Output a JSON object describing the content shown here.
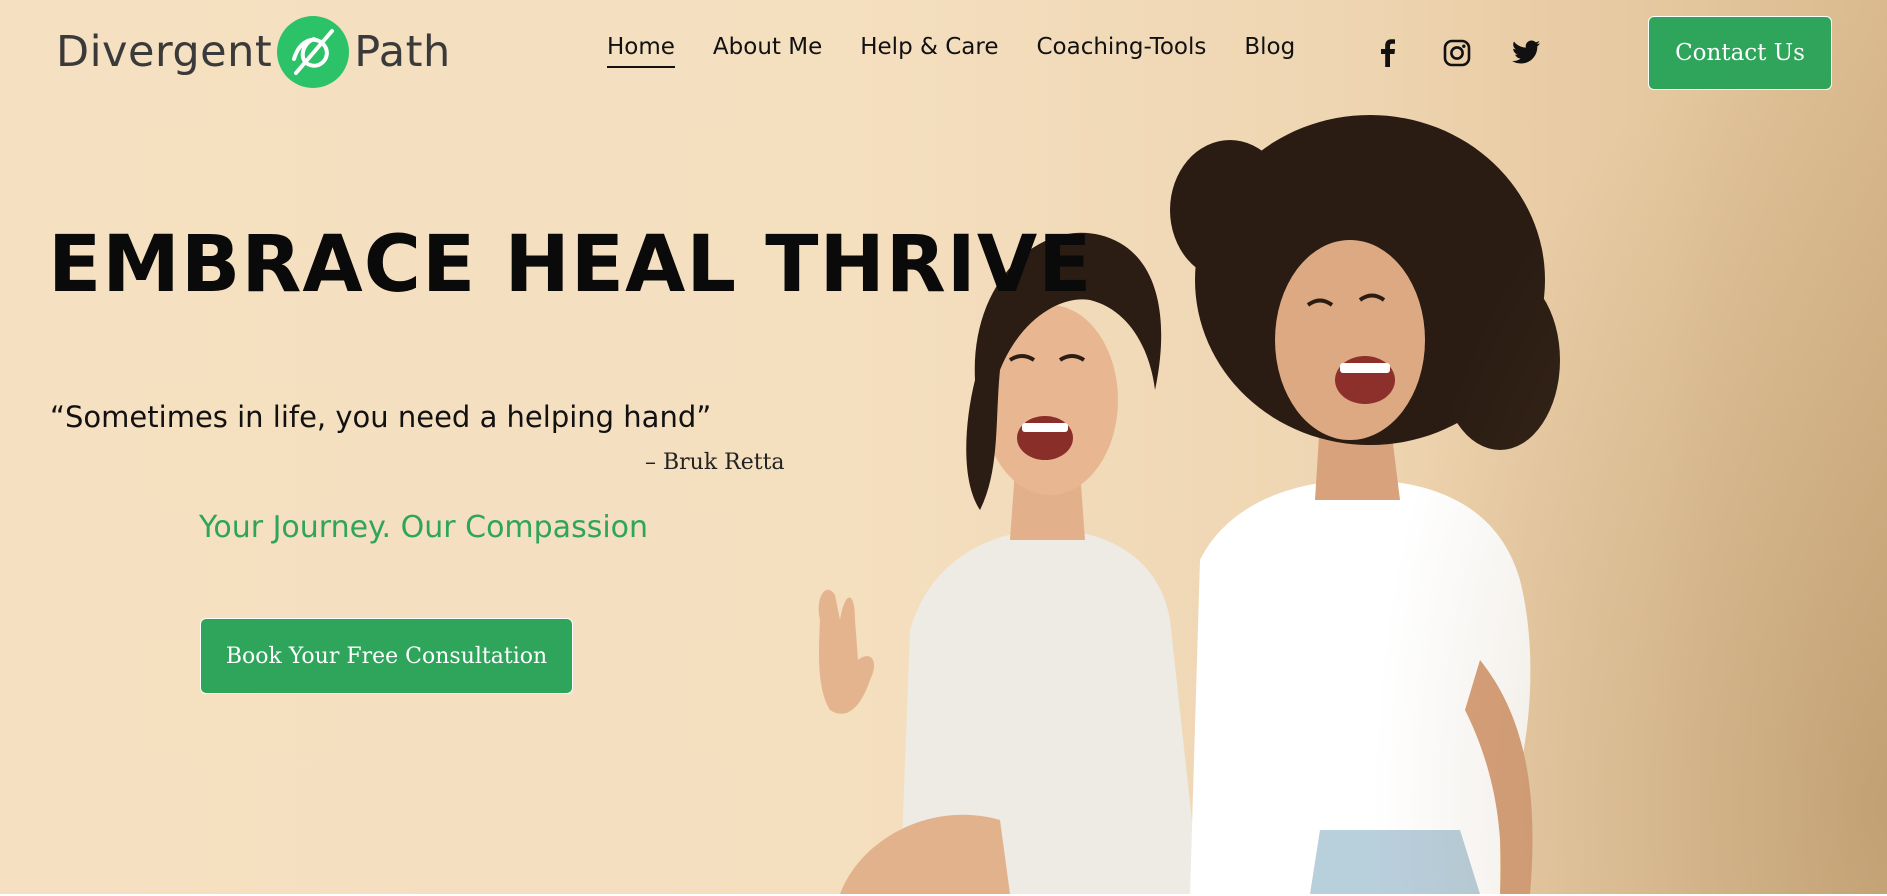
{
  "header": {
    "logo": {
      "left": "Divergent",
      "right": "Path",
      "mark_icon": "divergent-path-logo-icon"
    },
    "nav": [
      {
        "label": "Home",
        "active": true
      },
      {
        "label": "About Me",
        "active": false
      },
      {
        "label": "Help & Care",
        "active": false
      },
      {
        "label": "Coaching-Tools",
        "active": false
      },
      {
        "label": "Blog",
        "active": false
      }
    ],
    "social": [
      "facebook-icon",
      "instagram-icon",
      "twitter-icon"
    ],
    "contact_label": "Contact Us"
  },
  "hero": {
    "headline": "EMBRACE HEAL THRIVE",
    "quote": "“Sometimes in life, you need a helping hand”",
    "quote_author": "– Bruk Retta",
    "tagline": "Your Journey. Our Compassion",
    "cta_label": "Book Your Free Consultation"
  },
  "colors": {
    "accent": "#2ea55b",
    "background": "#f5e0c1",
    "text": "#111111"
  }
}
